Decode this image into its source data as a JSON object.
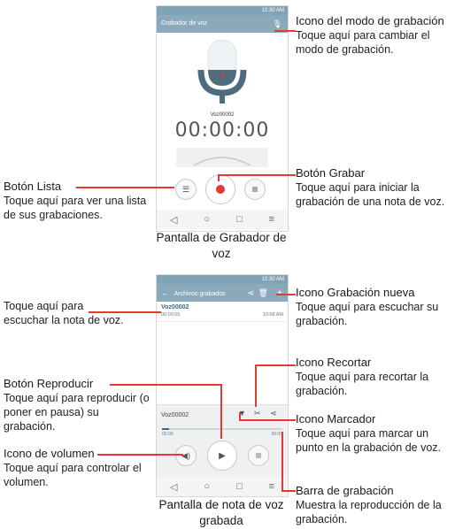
{
  "screen1": {
    "status_time": "10:30 AM",
    "title": "Grabador de voz",
    "file_name": "Voz00002",
    "timer": "00:00:00",
    "nav_icons": [
      "◁",
      "○",
      "□",
      "≡"
    ]
  },
  "screen2": {
    "status_time": "10:30 AM",
    "title": "Archivos grabados",
    "item_name": "Voz00002",
    "item_duration": "00:00:05",
    "item_time": "10:58 AM",
    "player_name": "Voz00002",
    "progress_start": "00:00",
    "progress_end": "00:05",
    "progress_fraction": 0.06,
    "nav_icons": [
      "◁",
      "○",
      "□",
      "≡"
    ]
  },
  "callouts": {
    "mode_icon_title": "Icono del modo de grabación",
    "mode_icon_body": "Toque aquí para cambiar el modo de grabación.",
    "list_button_title": "Botón Lista",
    "list_button_body": "Toque aquí para ver una lista de sus grabaciones.",
    "record_button_title": "Botón Grabar",
    "record_button_body": "Toque aquí para iniciar la grabación de una nota de voz.",
    "caption1": "Pantalla de Grabador de voz",
    "listen_body": "Toque aquí para escuchar la nota de voz.",
    "new_rec_title": "Icono Grabación nueva",
    "new_rec_body": "Toque aquí para escuchar su grabación.",
    "trim_title": "Icono Recortar",
    "trim_body": "Toque aquí para recortar la grabación.",
    "play_title": "Botón Reproducir",
    "play_body": "Toque aquí para reproducir (o poner en pausa) su grabación.",
    "bookmark_title": "Icono Marcador",
    "bookmark_body": "Toque aquí para marcar un punto en la grabación de voz.",
    "volume_title": "Icono de volumen",
    "volume_body": "Toque aquí para controlar el volumen.",
    "bar_title": "Barra de grabación",
    "bar_body": "Muestra la reproducción de la grabación.",
    "caption2": "Pantalla de nota de voz grabada"
  },
  "colors": {
    "accent": "#e53935",
    "appbar": "#8aa9bb"
  }
}
